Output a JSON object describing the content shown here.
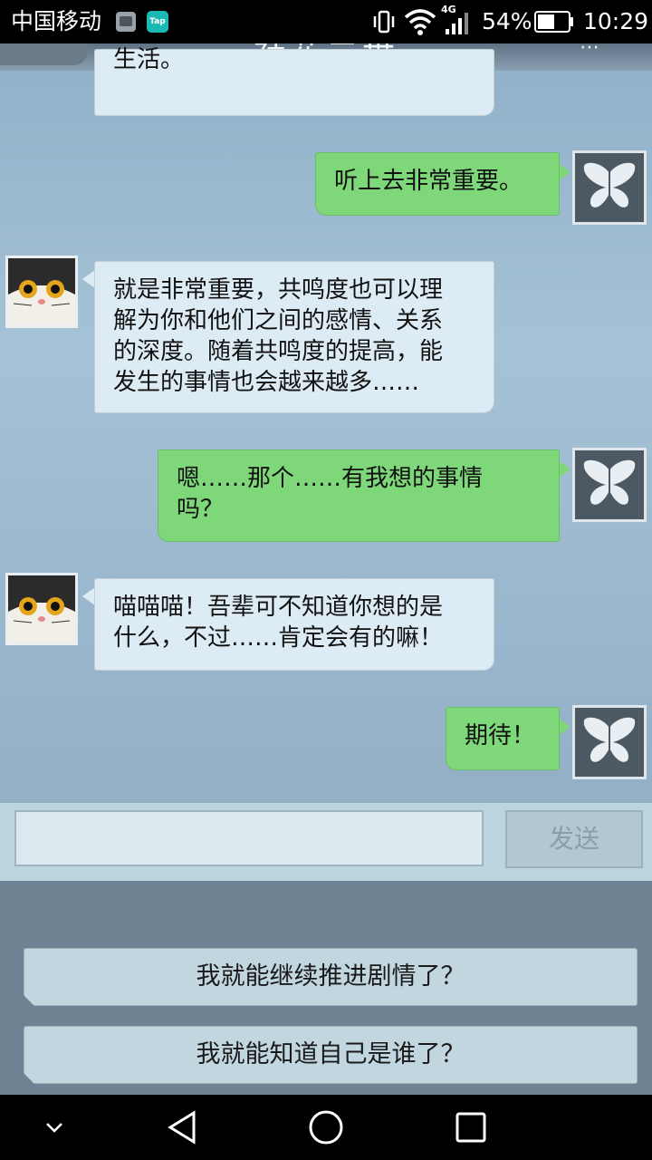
{
  "status_bar": {
    "carrier": "中国移动",
    "tap_label": "Tap",
    "network": "4G",
    "battery": "54%",
    "time": "10:29"
  },
  "chat": {
    "title": "社花二世",
    "messages": [
      {
        "side": "left",
        "text": "生活。"
      },
      {
        "side": "right",
        "text": "听上去非常重要。"
      },
      {
        "side": "left",
        "lines": [
          "就是非常重要，共鸣度也可以理",
          "解为你和他们之间的感情、关系",
          "的深度。随着共鸣度的提高，能",
          "发生的事情也会越来越多……"
        ]
      },
      {
        "side": "right",
        "lines": [
          "嗯……那个……有我想的事情",
          "吗？"
        ]
      },
      {
        "side": "left",
        "lines": [
          "喵喵喵！吾辈可不知道你想的是",
          "什么，不过……肯定会有的嘛！"
        ]
      },
      {
        "side": "right",
        "text": "期待！"
      }
    ]
  },
  "input": {
    "value": "",
    "send_label": "发送"
  },
  "choices": [
    "我就能继续推进剧情了？",
    "我就能知道自己是谁了？"
  ],
  "colors": {
    "right_bubble": "#7ed87a",
    "left_bubble": "#ddecf4"
  }
}
